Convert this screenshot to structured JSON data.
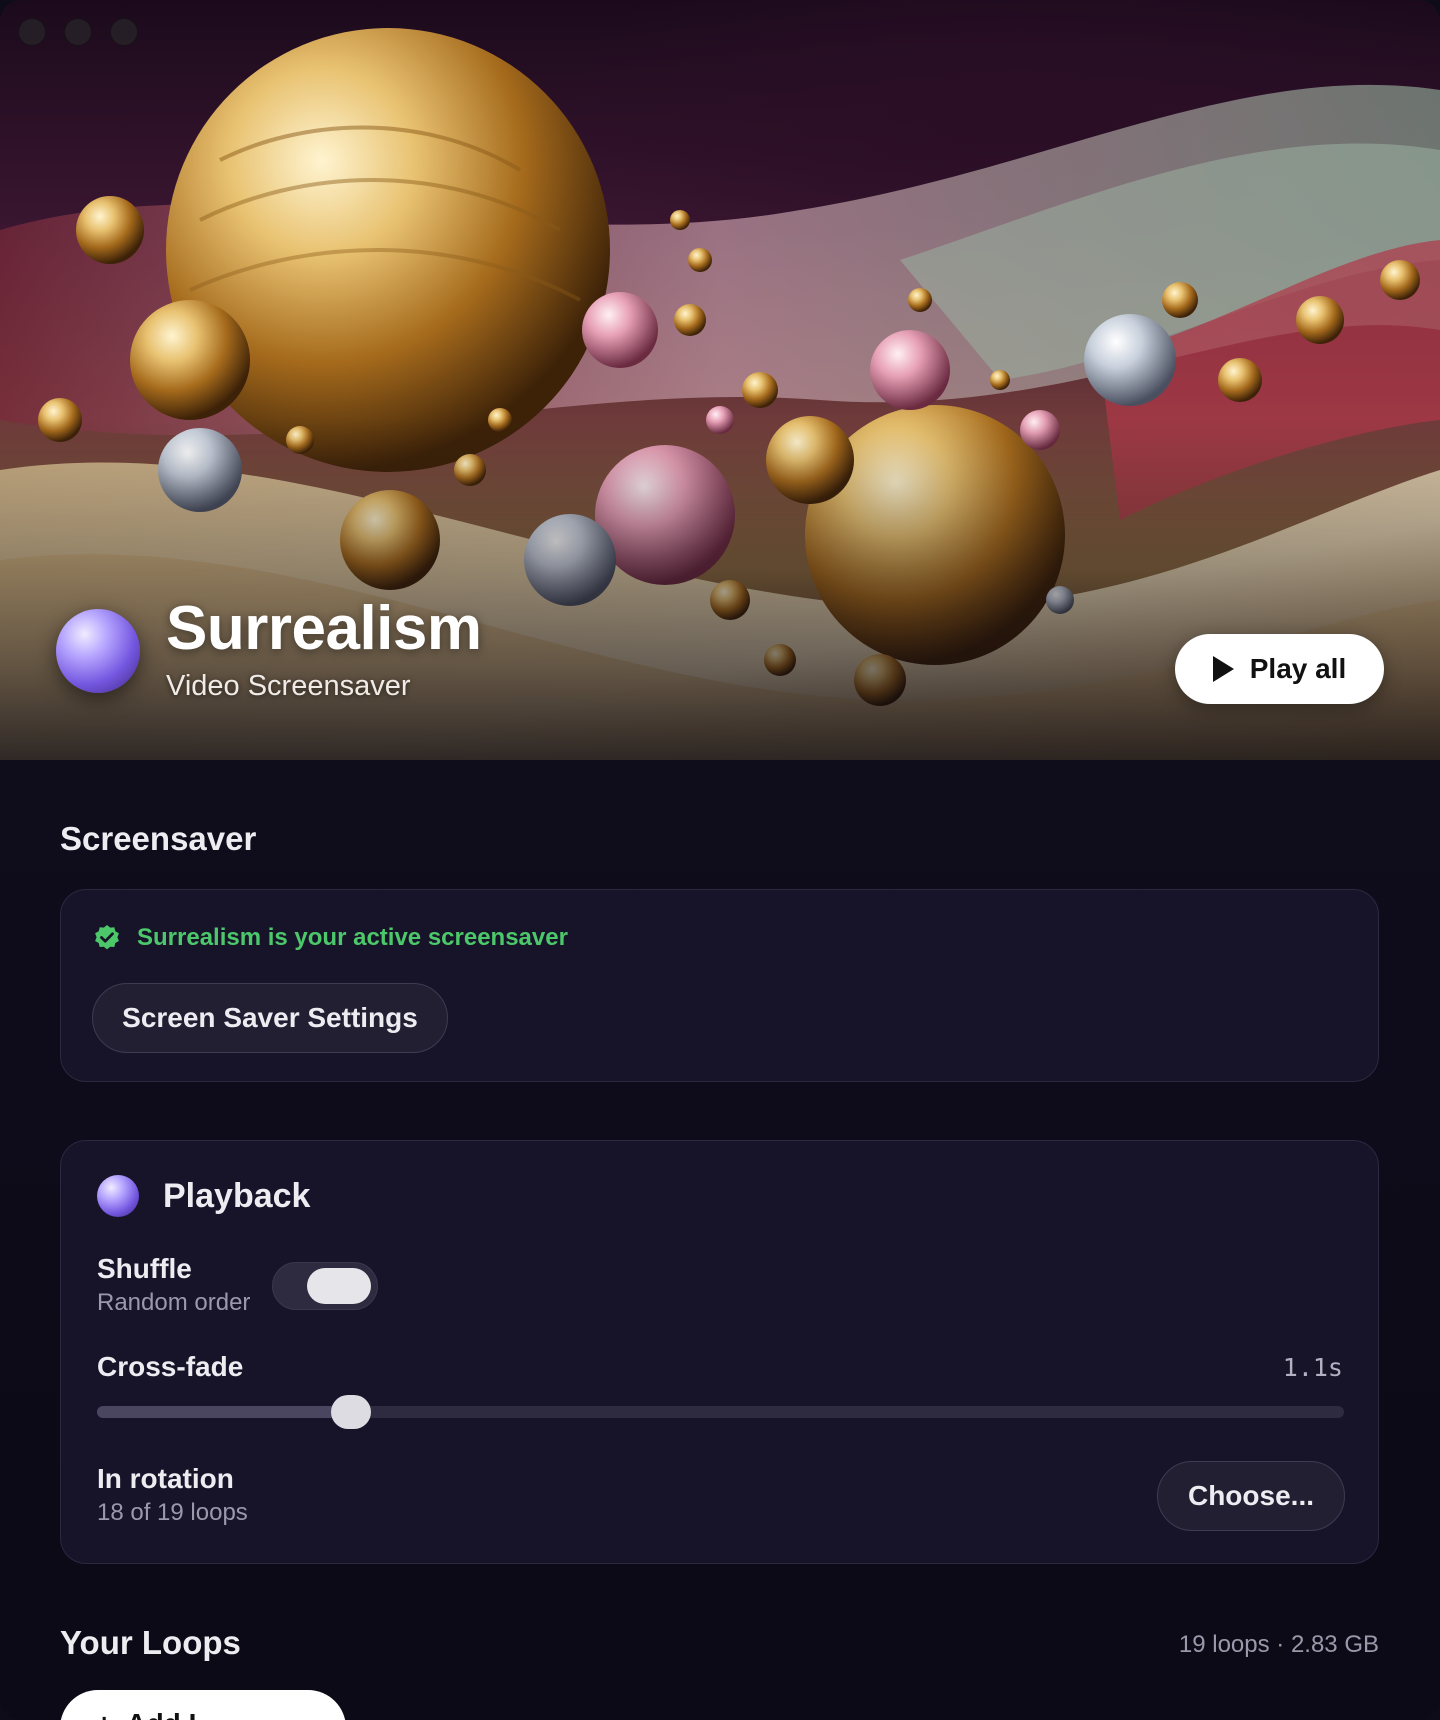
{
  "hero": {
    "title": "Surrealism",
    "subtitle": "Video Screensaver",
    "play_all_label": "Play all"
  },
  "screensaver": {
    "section_title": "Screensaver",
    "status_text": "Surrealism is your active screensaver",
    "status_color": "#4cc76a",
    "settings_button_label": "Screen Saver Settings"
  },
  "playback": {
    "title": "Playback",
    "shuffle": {
      "label": "Shuffle",
      "sublabel": "Random order",
      "enabled": true
    },
    "crossfade": {
      "label": "Cross-fade",
      "value_text": "1.1s",
      "fraction": 0.204
    },
    "rotation": {
      "label": "In rotation",
      "sublabel": "18 of 19 loops",
      "button_label": "Choose..."
    }
  },
  "loops": {
    "section_title": "Your Loops",
    "meta": "19 loops · 2.83 GB",
    "add_button_label": "Add L"
  },
  "colors": {
    "accent_orb": "#7457e0",
    "background": "#0f0c1a",
    "card": "#17142a"
  },
  "icons": [
    "verified-check-icon",
    "play-icon",
    "plus-icon",
    "app-orb-icon"
  ]
}
